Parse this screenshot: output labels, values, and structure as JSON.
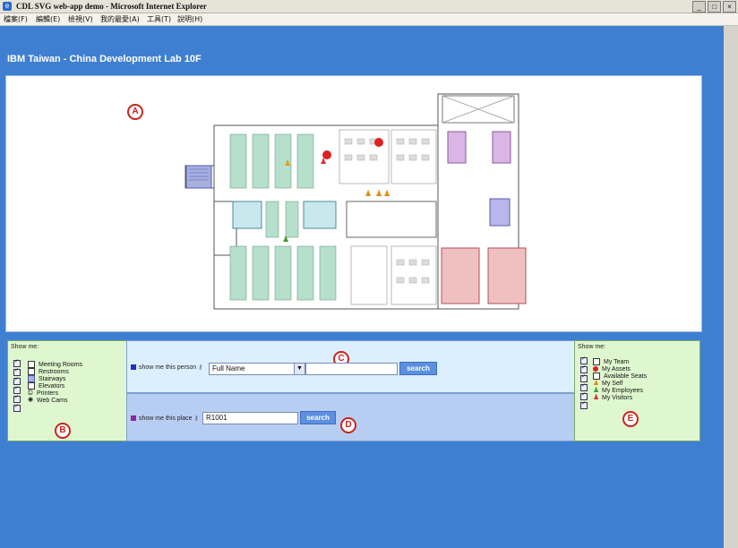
{
  "window": {
    "title": "CDL SVG web-app demo - Microsoft Internet Explorer",
    "buttons": [
      "_",
      "□",
      "×"
    ]
  },
  "menubar": {
    "items": [
      "檔案(F)",
      "編輯(E)",
      "檢視(V)",
      "我的最愛(A)",
      "工具(T)",
      "說明(H)"
    ]
  },
  "page": {
    "heading": "IBM Taiwan - China Development Lab 10F"
  },
  "markers": {
    "a": "A",
    "b": "B",
    "c": "C",
    "d": "D",
    "e": "E"
  },
  "panel_b": {
    "show_label": "Show me:",
    "items": [
      {
        "label": "Meeting Rooms",
        "icon": "checkbox"
      },
      {
        "label": "Restrooms",
        "icon": "checkbox"
      },
      {
        "label": "Stairways",
        "icon": "stair"
      },
      {
        "label": "Elevators",
        "icon": "checkbox"
      },
      {
        "label": "Printers",
        "icon": "printer"
      },
      {
        "label": "Web Cams",
        "icon": "webcam"
      }
    ]
  },
  "panel_c": {
    "label": "show me this person",
    "select_value": "Full Name",
    "input_value": "",
    "button_label": "search",
    "square_color": "#1f2fc8"
  },
  "panel_d": {
    "label": "show me this place",
    "input_value": "R1001",
    "button_label": "search",
    "square_color": "#8a2a9a"
  },
  "panel_e": {
    "show_label": "Show me:",
    "items": [
      {
        "label": "My Team",
        "icon": "checkbox"
      },
      {
        "label": "My Assets",
        "icon": "red-dot"
      },
      {
        "label": "Available Seats",
        "icon": "checkbox"
      },
      {
        "label": "My Self",
        "icon": "person-orange"
      },
      {
        "label": "My Employees",
        "icon": "person-green"
      },
      {
        "label": "My Visitors",
        "icon": "person-red"
      }
    ]
  }
}
